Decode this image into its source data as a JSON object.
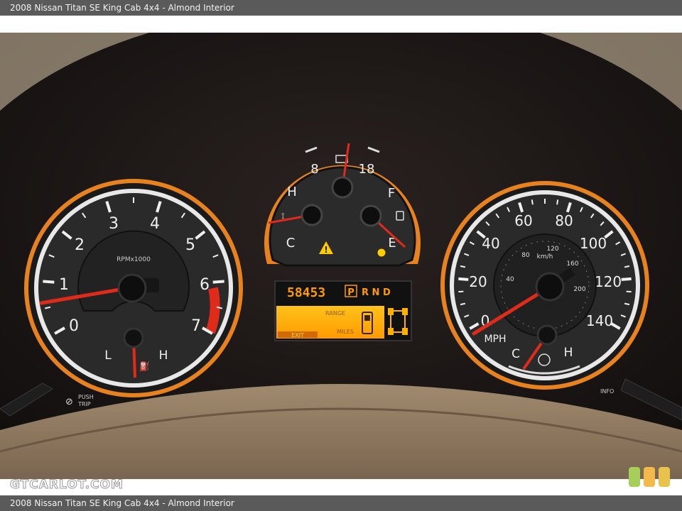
{
  "caption": "2008 Nissan Titan SE King Cab 4x4 - Almond Interior",
  "watermark": "GTCARLOT.COM",
  "tachometer": {
    "scale_label": "RPMx1000",
    "ticks": [
      "0",
      "1",
      "2",
      "3",
      "4",
      "5",
      "6",
      "7"
    ],
    "oil_gauge": {
      "low": "L",
      "high": "H"
    }
  },
  "center_gauge": {
    "voltage_ticks": [
      "8",
      "18"
    ],
    "temp": {
      "cold": "C",
      "hot": "H"
    },
    "fuel": {
      "full": "F",
      "empty": "E"
    }
  },
  "speedometer": {
    "unit": "MPH",
    "ticks": [
      "0",
      "20",
      "40",
      "60",
      "80",
      "100",
      "120",
      "140"
    ],
    "kmh_unit": "km/h",
    "kmh_ticks": [
      "40",
      "80",
      "120",
      "160",
      "200"
    ],
    "trans_temp": {
      "cold": "C",
      "hot": "H"
    }
  },
  "display": {
    "odometer": "58453",
    "gear_selected": "P",
    "gears": "R N D",
    "range_label": "RANGE",
    "miles_label": "MILES",
    "exit_label": "EXIT"
  },
  "buttons": {
    "push_trip": "PUSH TRIP",
    "info": "INFO"
  },
  "colors": {
    "accent_orange": "#e8821e",
    "needle_red": "#e02a1a",
    "lcd_amber": "#ffb000"
  }
}
